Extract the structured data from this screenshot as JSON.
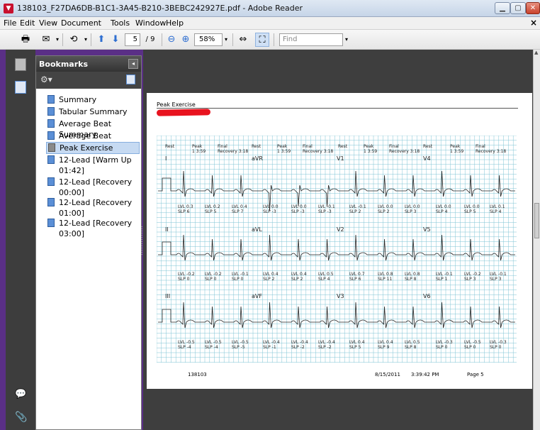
{
  "window": {
    "title": "138103_F27DA6DB-B1C1-3A45-B210-3BEBC242927E.pdf - Adobe Reader",
    "min_icon": "window-minimize-icon",
    "max_icon": "window-maximize-icon",
    "close_icon": "window-close-icon"
  },
  "menu": {
    "items": [
      {
        "label": "File"
      },
      {
        "label": "Edit"
      },
      {
        "label": "View"
      },
      {
        "label": "Document"
      },
      {
        "label": "Tools"
      },
      {
        "label": "Window"
      },
      {
        "label": "Help"
      }
    ],
    "close_glyph": "×"
  },
  "toolbar": {
    "page_current": "5",
    "page_total": "/ 9",
    "zoom": "58%",
    "find_placeholder": "Find"
  },
  "bookmarks": {
    "title": "Bookmarks",
    "items": [
      {
        "label": "Summary"
      },
      {
        "label": "Tabular Summary"
      },
      {
        "label": "Average Beat Summary"
      },
      {
        "label": "Average Beat Summary"
      },
      {
        "label": "Peak Exercise"
      },
      {
        "label": "12-Lead [Warm Up 01:42]"
      },
      {
        "label": "12-Lead [Recovery 00:00]"
      },
      {
        "label": "12-Lead [Recovery 01:00]"
      },
      {
        "label": "12-Lead [Recovery 03:00]"
      }
    ]
  },
  "document": {
    "heading": "Peak Exercise",
    "footer_id": "138103",
    "footer_date": "8/15/2011",
    "footer_time": "3:39:42 PM",
    "footer_page": "Page 5",
    "ecg": {
      "grid_color": "#7fc4d4",
      "header_labels": [
        {
          "t": "Rest"
        },
        {
          "t": "Peak"
        },
        {
          "t": "Final"
        },
        {
          "t": "Rest"
        },
        {
          "t": "Peak"
        },
        {
          "t": "Final"
        },
        {
          "t": "Rest"
        },
        {
          "t": "Peak"
        },
        {
          "t": "Final"
        },
        {
          "t": "Rest"
        },
        {
          "t": "Peak"
        },
        {
          "t": "Final"
        }
      ],
      "header_sub": [
        {
          "t": "1  3:59"
        },
        {
          "t": "Recovery 3:18"
        },
        {
          "t": "1  3:59"
        },
        {
          "t": "Recovery 3:18"
        },
        {
          "t": "1  3:59"
        },
        {
          "t": "Recovery 3:18"
        },
        {
          "t": "1  3:59"
        },
        {
          "t": "Recovery 3:18"
        }
      ],
      "leads": [
        {
          "t": "I"
        },
        {
          "t": "aVR"
        },
        {
          "t": "V1"
        },
        {
          "t": "V4"
        },
        {
          "t": "II"
        },
        {
          "t": "aVL"
        },
        {
          "t": "V2"
        },
        {
          "t": "V5"
        },
        {
          "t": "III"
        },
        {
          "t": "aVF"
        },
        {
          "t": "V3"
        },
        {
          "t": "V6"
        }
      ],
      "row1_lvl": [
        "LVL 0.3",
        "LVL 0.2",
        "LVL 0.4",
        "LVL 0.0",
        "LVL 0.0",
        "LVL -0.1",
        "LVL -0.1",
        "LVL 0.0",
        "LVL 0.0",
        "LVL 0.0",
        "LVL 0.0",
        "LVL 0.1"
      ],
      "row1_slp": [
        "SLP 6",
        "SLP 5",
        "SLP 7",
        "SLP -3",
        "SLP -3",
        "SLP -3",
        "SLP 2",
        "SLP 2",
        "SLP 3",
        "SLP 4",
        "SLP 5",
        "SLP 4"
      ],
      "row2_lvl": [
        "LVL -0.2",
        "LVL -0.2",
        "LVL -0.1",
        "LVL 0.4",
        "LVL 0.4",
        "LVL 0.5",
        "LVL 0.7",
        "LVL 0.8",
        "LVL 0.8",
        "LVL -0.1",
        "LVL -0.2",
        "LVL -0.1"
      ],
      "row2_slp": [
        "SLP 0",
        "SLP 0",
        "SLP 0",
        "SLP 2",
        "SLP 2",
        "SLP 4",
        "SLP 6",
        "SLP 11",
        "SLP 8",
        "SLP 1",
        "SLP 3",
        "SLP 3"
      ],
      "row3_lvl": [
        "LVL -0.5",
        "LVL -0.5",
        "LVL -0.5",
        "LVL -0.4",
        "LVL -0.4",
        "LVL -0.4",
        "LVL 0.4",
        "LVL 0.4",
        "LVL 0.5",
        "LVL -0.3",
        "LVL -0.5",
        "LVL -0.3"
      ],
      "row3_slp": [
        "SLP -4",
        "SLP -4",
        "SLP -5",
        "SLP -1",
        "SLP -2",
        "SLP -2",
        "SLP 5",
        "SLP 9",
        "SLP 8",
        "SLP 0",
        "SLP 0",
        "SLP 0"
      ]
    }
  }
}
